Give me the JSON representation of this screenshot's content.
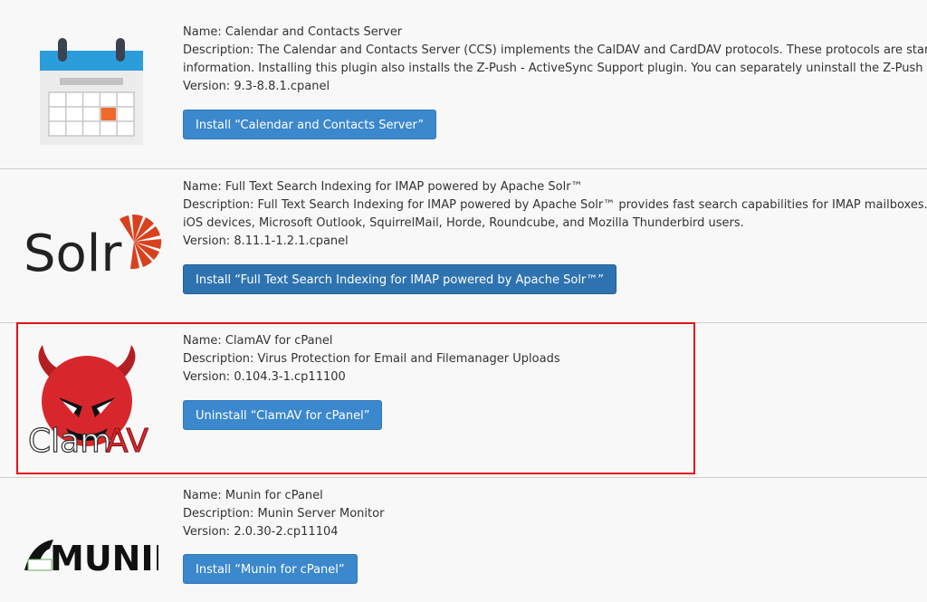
{
  "colors": {
    "button": "#3b88cd",
    "button_active": "#2e73b0",
    "highlight": "#e3111b",
    "separator": "#cfcfcf",
    "calendar_blue": "#2b9ddb",
    "calendar_accent": "#ef6a2a",
    "solr_orange": "#d9411e",
    "clamav_red": "#d8272c"
  },
  "plugins": [
    {
      "logo_icon": "calendar-icon",
      "name": "Name: Calendar and Contacts Server",
      "description_line1": "Description: The Calendar and Contacts Server (CCS) implements the CalDAV and CardDAV protocols. These protocols are stand",
      "description_line2": "information. Installing this plugin also installs the Z-Push - ActiveSync Support plugin. You can separately uninstall the Z-Push - A",
      "version": "Version: 9.3-8.8.1.cpanel",
      "button": "Install “Calendar and Contacts Server”"
    },
    {
      "logo_icon": "solr-logo",
      "logo_text": "Solr",
      "name": "Name: Full Text Search Indexing for IMAP powered by Apache Solr™",
      "description_line1": "Description: Full Text Search Indexing for IMAP powered by Apache Solr™ provides fast search capabilities for IMAP mailboxes. T",
      "description_line2": "iOS devices, Microsoft Outlook, SquirrelMail, Horde, Roundcube, and Mozilla Thunderbird users.",
      "version": "Version: 8.11.1-1.2.1.cpanel",
      "button": "Install “Full Text Search Indexing for IMAP powered by Apache Solr™”"
    },
    {
      "logo_icon": "clamav-logo",
      "logo_text_a": "Clam",
      "logo_text_b": "AV",
      "name": "Name: ClamAV for cPanel",
      "description": "Description: Virus Protection for Email and Filemanager Uploads",
      "version": "Version: 0.104.3-1.cp11100",
      "button": "Uninstall “ClamAV for cPanel”"
    },
    {
      "logo_icon": "munin-logo",
      "logo_text": "MUNIN",
      "name": "Name: Munin for cPanel",
      "description": "Description: Munin Server Monitor",
      "version": "Version: 2.0.30-2.cp11104",
      "button": "Install “Munin for cPanel”"
    }
  ]
}
